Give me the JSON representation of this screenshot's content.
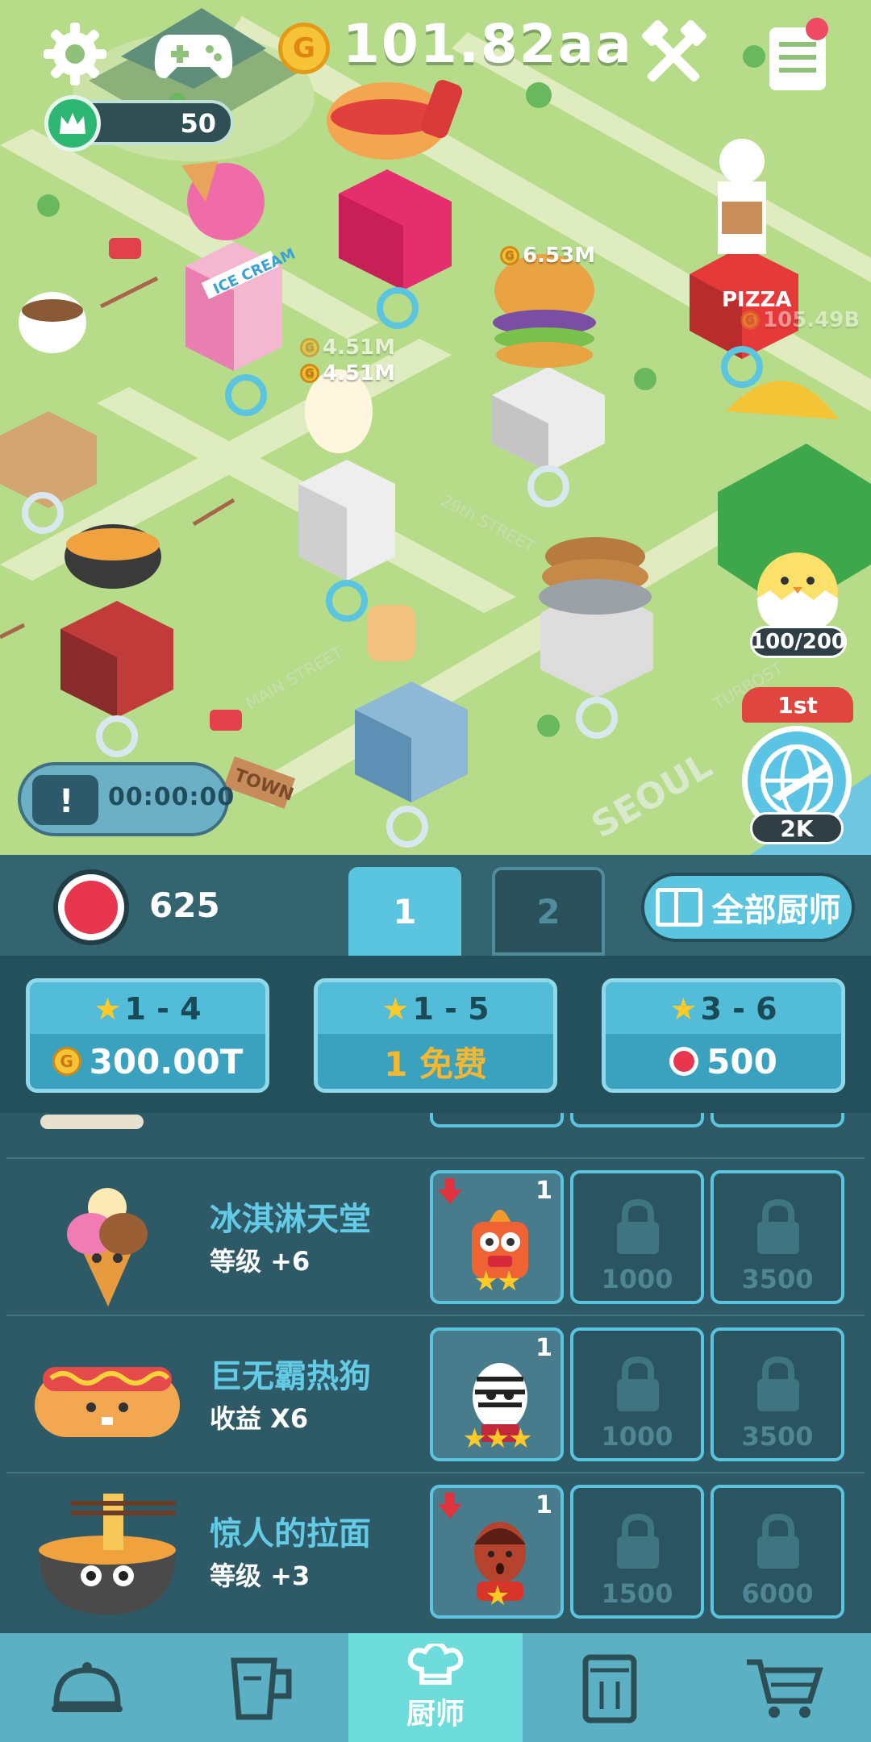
{
  "hud": {
    "money": "101.82aa",
    "level": "50",
    "timer": "00:00:00",
    "chick_capacity": "100/200",
    "rank_place": "1st",
    "rank_count": "2K"
  },
  "map_labels": {
    "burger_income": "6.53M",
    "chicken_income_1": "4.51M",
    "chicken_income_2": "4.51M",
    "pizza_income": "105.49B",
    "ice_cream_sign": "ICE CREAM",
    "pizza_sign": "PIZZA",
    "town_sign": "TOWN",
    "seoul_label": "SEOUL",
    "street_1": "29th STREET",
    "street_2": "MAIN STREET",
    "street_3": "TURBOST"
  },
  "panel": {
    "gems": "625",
    "page_tabs": [
      "1",
      "2"
    ],
    "all_chefs_label": "全部厨师",
    "draws": [
      {
        "stars": "1 - 4",
        "cost": "300.00T",
        "currency": "coin"
      },
      {
        "stars": "1 - 5",
        "cost": "1 免费",
        "currency": "free"
      },
      {
        "stars": "3 - 6",
        "cost": "500",
        "currency": "gem"
      }
    ],
    "restaurants": [
      {
        "name": "冰淇淋天堂",
        "bonus": "等级 +6",
        "chef_level": "1",
        "chef_stars": 2,
        "downgrade": true,
        "slot_prices": [
          "1000",
          "3500"
        ]
      },
      {
        "name": "巨无霸热狗",
        "bonus": "收益 X6",
        "chef_level": "1",
        "chef_stars": 3,
        "downgrade": false,
        "slot_prices": [
          "1000",
          "3500"
        ]
      },
      {
        "name": "惊人的拉面",
        "bonus": "等级 +3",
        "chef_level": "1",
        "chef_stars": 1,
        "downgrade": true,
        "slot_prices": [
          "1500",
          "6000"
        ]
      }
    ],
    "partial_prices": [
      "1000",
      "3500"
    ]
  },
  "nav": {
    "items": [
      "serve",
      "drink",
      "chef",
      "menu",
      "shop"
    ],
    "active_label": "厨师"
  },
  "colors": {
    "accent": "#5bc4df",
    "panel_bg": "#2d5a66",
    "map_bg": "#b6dc8a",
    "gold": "#f6c336",
    "gem": "#e8364f",
    "active_nav": "#6fdcdc"
  }
}
